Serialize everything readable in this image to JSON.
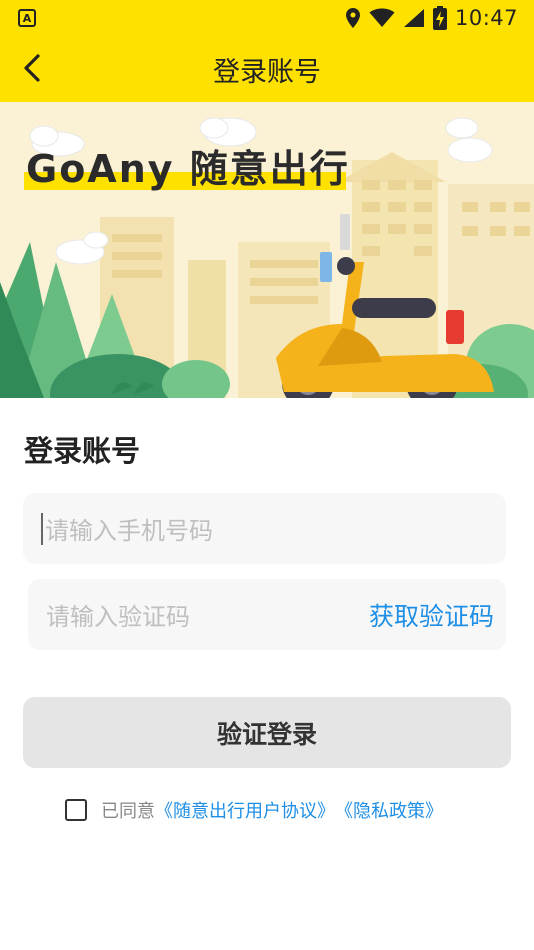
{
  "status_bar": {
    "time": "10:47",
    "notification_icon": "accessibility-a-icon",
    "icons": [
      "location-icon",
      "wifi-icon",
      "signal-icon",
      "battery-charging-icon"
    ]
  },
  "header": {
    "back_icon": "chevron-left-icon",
    "title": "登录账号"
  },
  "banner": {
    "headline": "GoAny 随意出行",
    "accent_color": "#FFE100"
  },
  "form": {
    "section_title": "登录账号",
    "phone_placeholder": "请输入手机号码",
    "code_placeholder": "请输入验证码",
    "get_code_label": "获取验证码",
    "submit_label": "验证登录"
  },
  "agreement": {
    "checked": false,
    "prefix": "已同意",
    "user_agreement": "《随意出行用户协议》",
    "privacy_policy": "《隐私政策》"
  },
  "colors": {
    "brand_yellow": "#FFE100",
    "link_blue": "#1E8FE6",
    "button_disabled": "#E5E5E5"
  }
}
